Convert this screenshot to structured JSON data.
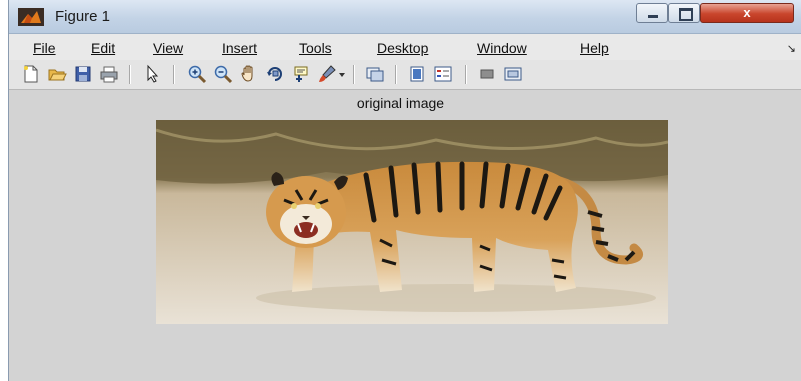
{
  "window": {
    "title": "Figure 1",
    "close_glyph": "x"
  },
  "menu": [
    {
      "label": "File"
    },
    {
      "label": "Edit"
    },
    {
      "label": "View"
    },
    {
      "label": "Insert"
    },
    {
      "label": "Tools"
    },
    {
      "label": "Desktop"
    },
    {
      "label": "Window"
    },
    {
      "label": "Help"
    }
  ],
  "toolbar_icons": [
    "new-figure-icon",
    "open-file-icon",
    "save-icon",
    "print-icon",
    "pointer-icon",
    "zoom-in-icon",
    "zoom-out-icon",
    "pan-hand-icon",
    "rotate-3d-icon",
    "data-cursor-icon",
    "brush-icon",
    "dropdown-arrow-icon",
    "link-plot-icon",
    "colorbar-icon",
    "legend-icon",
    "hide-plot-tools-icon",
    "show-plot-tools-icon"
  ],
  "axes": {
    "title": "original image"
  },
  "image": {
    "subject": "tiger",
    "alt_icon": "photo-image"
  }
}
